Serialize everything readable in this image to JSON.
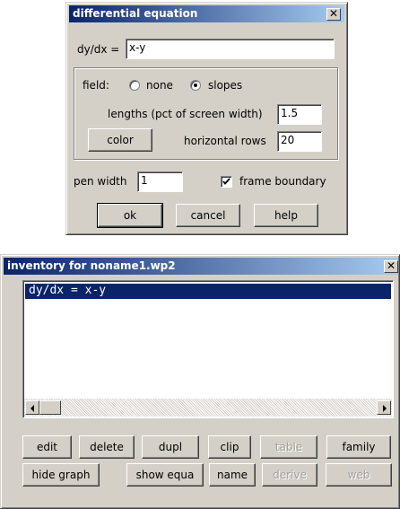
{
  "dialog": {
    "title": "differential equation",
    "close_glyph": "✕",
    "equation_label": "dy/dx =",
    "equation_value": "x-y",
    "field_label": "field:",
    "radio_none_label": "none",
    "radio_slopes_label": "slopes",
    "field_selected": "slopes",
    "lengths_label": "lengths (pct of screen width)",
    "lengths_value": "1.5",
    "color_button": "color",
    "rows_label": "horizontal rows",
    "rows_value": "20",
    "pen_width_label": "pen width",
    "pen_width_value": "1",
    "frame_boundary_label": "frame boundary",
    "frame_boundary_checked": true,
    "ok_button": "ok",
    "cancel_button": "cancel",
    "help_button": "help"
  },
  "inventory": {
    "title": "inventory for noname1.wp2",
    "close_glyph": "✕",
    "items": [
      "dy/dx = x-y"
    ],
    "buttons_row1": [
      {
        "label": "edit",
        "enabled": true
      },
      {
        "label": "delete",
        "enabled": true
      },
      {
        "label": "dupl",
        "enabled": true
      },
      {
        "label": "clip",
        "enabled": true
      },
      {
        "label": "table",
        "enabled": false
      },
      {
        "label": "family",
        "enabled": true
      }
    ],
    "buttons_row2": [
      {
        "label": "hide graph",
        "enabled": true
      },
      {
        "label": "show equa",
        "enabled": true
      },
      {
        "label": "name",
        "enabled": true
      },
      {
        "label": "derive",
        "enabled": false
      },
      {
        "label": "web",
        "enabled": false
      }
    ]
  },
  "colors": {
    "face": "#d4d0c8",
    "title_active_start": "#0a246a",
    "title_active_end": "#a6caf0",
    "selection": "#0a246a"
  }
}
